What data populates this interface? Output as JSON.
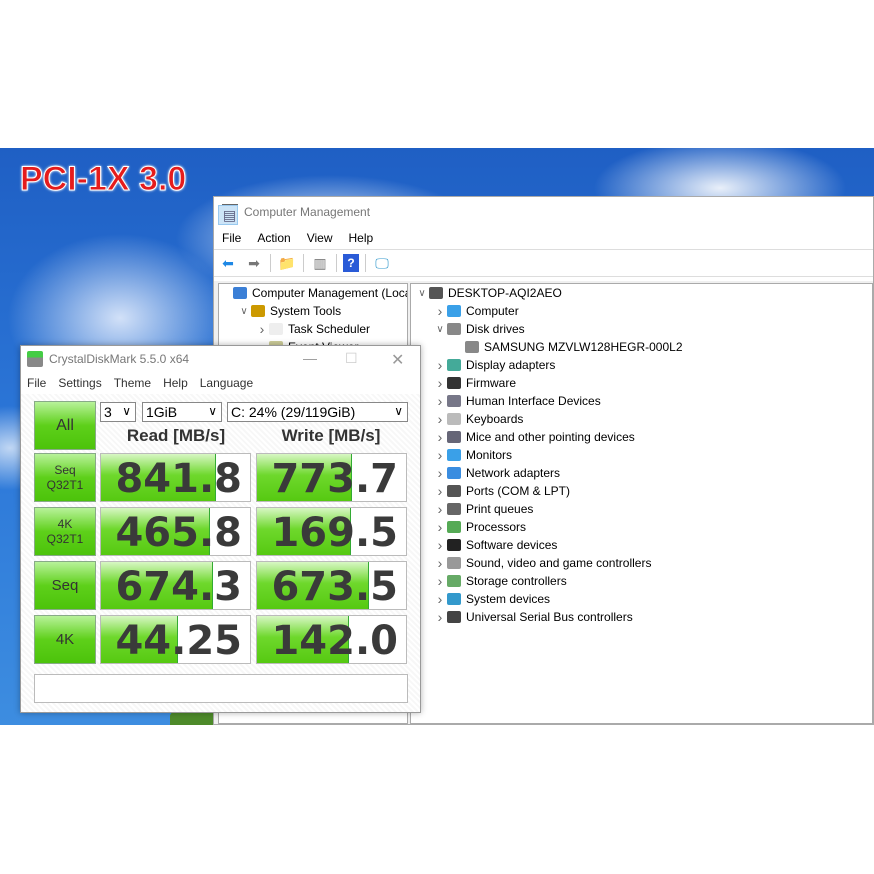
{
  "overlay_title": "PCI-1X 3.0",
  "computer_management": {
    "title": "Computer Management",
    "menu": [
      "File",
      "Action",
      "View",
      "Help"
    ],
    "toolbar_icons": [
      "back-arrow-icon",
      "forward-arrow-icon",
      "up-folder-icon",
      "show-hide-tree-icon",
      "properties-icon",
      "help-icon",
      "action-pane-icon",
      "monitor-icon"
    ],
    "left_tree": [
      {
        "label": "Computer Management (Local",
        "icon": "computer-management-icon",
        "level": 0,
        "chevron": ""
      },
      {
        "label": "System Tools",
        "icon": "tools-icon",
        "level": 1,
        "chevron": "v"
      },
      {
        "label": "Task Scheduler",
        "icon": "clock-icon",
        "level": 2,
        "chevron": ">"
      },
      {
        "label": "Event Viewer",
        "icon": "event-viewer-icon",
        "level": 2,
        "chevron": ">"
      }
    ],
    "device_tree": [
      {
        "label": "DESKTOP-AQI2AEO",
        "icon": "computer-root-icon",
        "level": 0,
        "chevron": "v"
      },
      {
        "label": "Computer",
        "icon": "monitor-icon",
        "level": 1,
        "chevron": ">"
      },
      {
        "label": "Disk drives",
        "icon": "disk-drive-icon",
        "level": 1,
        "chevron": "v"
      },
      {
        "label": "SAMSUNG MZVLW128HEGR-000L2",
        "icon": "disk-drive-icon",
        "level": 2,
        "chevron": ""
      },
      {
        "label": "Display adapters",
        "icon": "display-adapter-icon",
        "level": 1,
        "chevron": ">"
      },
      {
        "label": "Firmware",
        "icon": "chip-icon",
        "level": 1,
        "chevron": ">"
      },
      {
        "label": "Human Interface Devices",
        "icon": "hid-icon",
        "level": 1,
        "chevron": ">"
      },
      {
        "label": "Keyboards",
        "icon": "keyboard-icon",
        "level": 1,
        "chevron": ">"
      },
      {
        "label": "Mice and other pointing devices",
        "icon": "mouse-icon",
        "level": 1,
        "chevron": ">"
      },
      {
        "label": "Monitors",
        "icon": "monitor-icon",
        "level": 1,
        "chevron": ">"
      },
      {
        "label": "Network adapters",
        "icon": "network-icon",
        "level": 1,
        "chevron": ">"
      },
      {
        "label": "Ports (COM & LPT)",
        "icon": "port-icon",
        "level": 1,
        "chevron": ">"
      },
      {
        "label": "Print queues",
        "icon": "printer-icon",
        "level": 1,
        "chevron": ">"
      },
      {
        "label": "Processors",
        "icon": "processor-icon",
        "level": 1,
        "chevron": ">"
      },
      {
        "label": "Software devices",
        "icon": "software-device-icon",
        "level": 1,
        "chevron": ">"
      },
      {
        "label": "Sound, video and game controllers",
        "icon": "speaker-icon",
        "level": 1,
        "chevron": ">"
      },
      {
        "label": "Storage controllers",
        "icon": "storage-controller-icon",
        "level": 1,
        "chevron": ">"
      },
      {
        "label": "System devices",
        "icon": "system-device-icon",
        "level": 1,
        "chevron": ">"
      },
      {
        "label": "Universal Serial Bus controllers",
        "icon": "usb-icon",
        "level": 1,
        "chevron": ">"
      }
    ]
  },
  "crystaldiskmark": {
    "title": "CrystalDiskMark 5.5.0 x64",
    "menu": [
      "File",
      "Settings",
      "Theme",
      "Help",
      "Language"
    ],
    "all_button": "All",
    "count": "3",
    "size": "1GiB",
    "drive": "C: 24% (29/119GiB)",
    "read_header": "Read [MB/s]",
    "write_header": "Write [MB/s]",
    "accent": "#5ed01a",
    "tests": [
      {
        "label_1": "Seq",
        "label_2": "Q32T1",
        "read": "841.8",
        "write": "773.7",
        "read_fill": 0.77,
        "write_fill": 0.64
      },
      {
        "label_1": "4K",
        "label_2": "Q32T1",
        "read": "465.8",
        "write": "169.5",
        "read_fill": 0.73,
        "write_fill": 0.63
      },
      {
        "label_1": "Seq",
        "label_2": "",
        "read": "674.3",
        "write": "673.5",
        "read_fill": 0.75,
        "write_fill": 0.75
      },
      {
        "label_1": "4K",
        "label_2": "",
        "read": "44.25",
        "write": "142.0",
        "read_fill": 0.52,
        "write_fill": 0.62
      }
    ],
    "status": ""
  }
}
